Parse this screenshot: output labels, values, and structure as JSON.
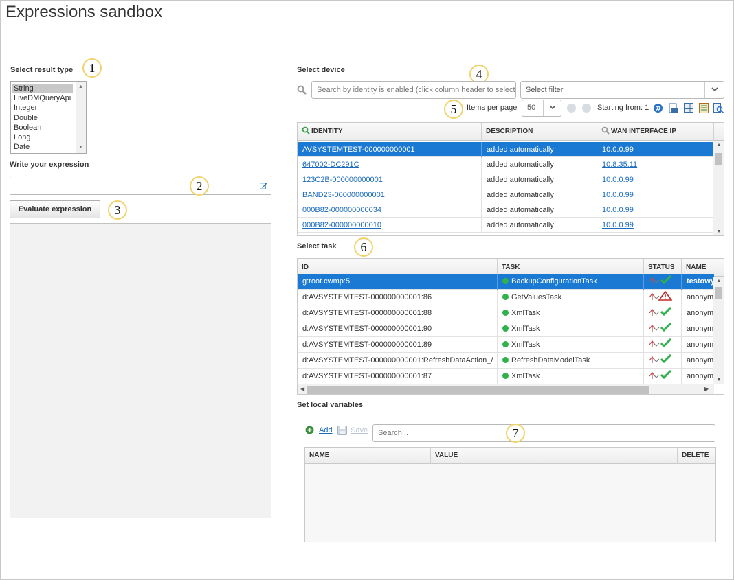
{
  "page": {
    "title": "Expressions sandbox"
  },
  "callouts": [
    "1",
    "2",
    "3",
    "4",
    "5",
    "6",
    "7"
  ],
  "left": {
    "result_type_label": "Select result type",
    "result_types": [
      "String",
      "LiveDMQueryApi",
      "Integer",
      "Double",
      "Boolean",
      "Long",
      "Date"
    ],
    "selected_result_type": "String",
    "expression_label": "Write your expression",
    "expression_value": "",
    "evaluate_label": "Evaluate expression"
  },
  "device": {
    "label": "Select device",
    "search_placeholder": "Search by identity is enabled (click column header to select)",
    "filter_placeholder": "Select filter",
    "items_per_page_label": "Items per page",
    "items_per_page": "50",
    "starting_from": "Starting from: 1",
    "columns": [
      "IDENTITY",
      "DESCRIPTION",
      "WAN INTERFACE IP"
    ],
    "rows": [
      {
        "identity": "AVSYSTEMTEST-000000000001",
        "description": "added automatically",
        "ip": "10.0.0.99",
        "selected": true
      },
      {
        "identity": "647002-DC291C",
        "description": "added automatically",
        "ip": "10.8.35.11"
      },
      {
        "identity": "123C2B-000000000001",
        "description": "added automatically",
        "ip": "10.0.0.99"
      },
      {
        "identity": "BAND23-000000000001",
        "description": "added automatically",
        "ip": "10.0.0.99"
      },
      {
        "identity": "000B82-000000000034",
        "description": "added automatically",
        "ip": "10.0.0.99"
      },
      {
        "identity": "000B82-000000000010",
        "description": "added automatically",
        "ip": "10.0.0.99"
      }
    ]
  },
  "task": {
    "label": "Select task",
    "columns": [
      "ID",
      "TASK",
      "STATUS",
      "NAME"
    ],
    "rows": [
      {
        "id": "g:root.cwmp:5",
        "task": "BackupConfigurationTask",
        "status": "ok",
        "name": "testowy",
        "selected": true
      },
      {
        "id": "d:AVSYSTEMTEST-000000000001:86",
        "task": "GetValuesTask",
        "status": "warning",
        "name": "anonym"
      },
      {
        "id": "d:AVSYSTEMTEST-000000000001:88",
        "task": "XmlTask",
        "status": "ok",
        "name": "anonym"
      },
      {
        "id": "d:AVSYSTEMTEST-000000000001:90",
        "task": "XmlTask",
        "status": "ok",
        "name": "anonym"
      },
      {
        "id": "d:AVSYSTEMTEST-000000000001:89",
        "task": "XmlTask",
        "status": "ok",
        "name": "anonym"
      },
      {
        "id": "d:AVSYSTEMTEST-000000000001:RefreshDataAction_/",
        "task": "RefreshDataModelTask",
        "status": "ok",
        "name": "anonym"
      },
      {
        "id": "d:AVSYSTEMTEST-000000000001:87",
        "task": "XmlTask",
        "status": "ok",
        "name": "anonym"
      }
    ]
  },
  "variables": {
    "label": "Set local variables",
    "add_label": "Add",
    "save_label": "Save",
    "search_placeholder": "Search...",
    "columns": [
      "NAME",
      "VALUE",
      "DELETE"
    ]
  },
  "colors": {
    "selection": "#1a79d3",
    "link": "#1a6bbd",
    "status_green": "#2fb24c",
    "callout_ring": "#f0d36a"
  },
  "icons": [
    "search-icon",
    "edit-icon",
    "chevron-down-icon",
    "first-page-icon",
    "prev-page-icon",
    "next-page-icon",
    "export-csv-icon",
    "export-table-icon",
    "export-xls-icon",
    "preview-icon",
    "add-icon",
    "save-icon",
    "check-icon",
    "warning-icon"
  ]
}
